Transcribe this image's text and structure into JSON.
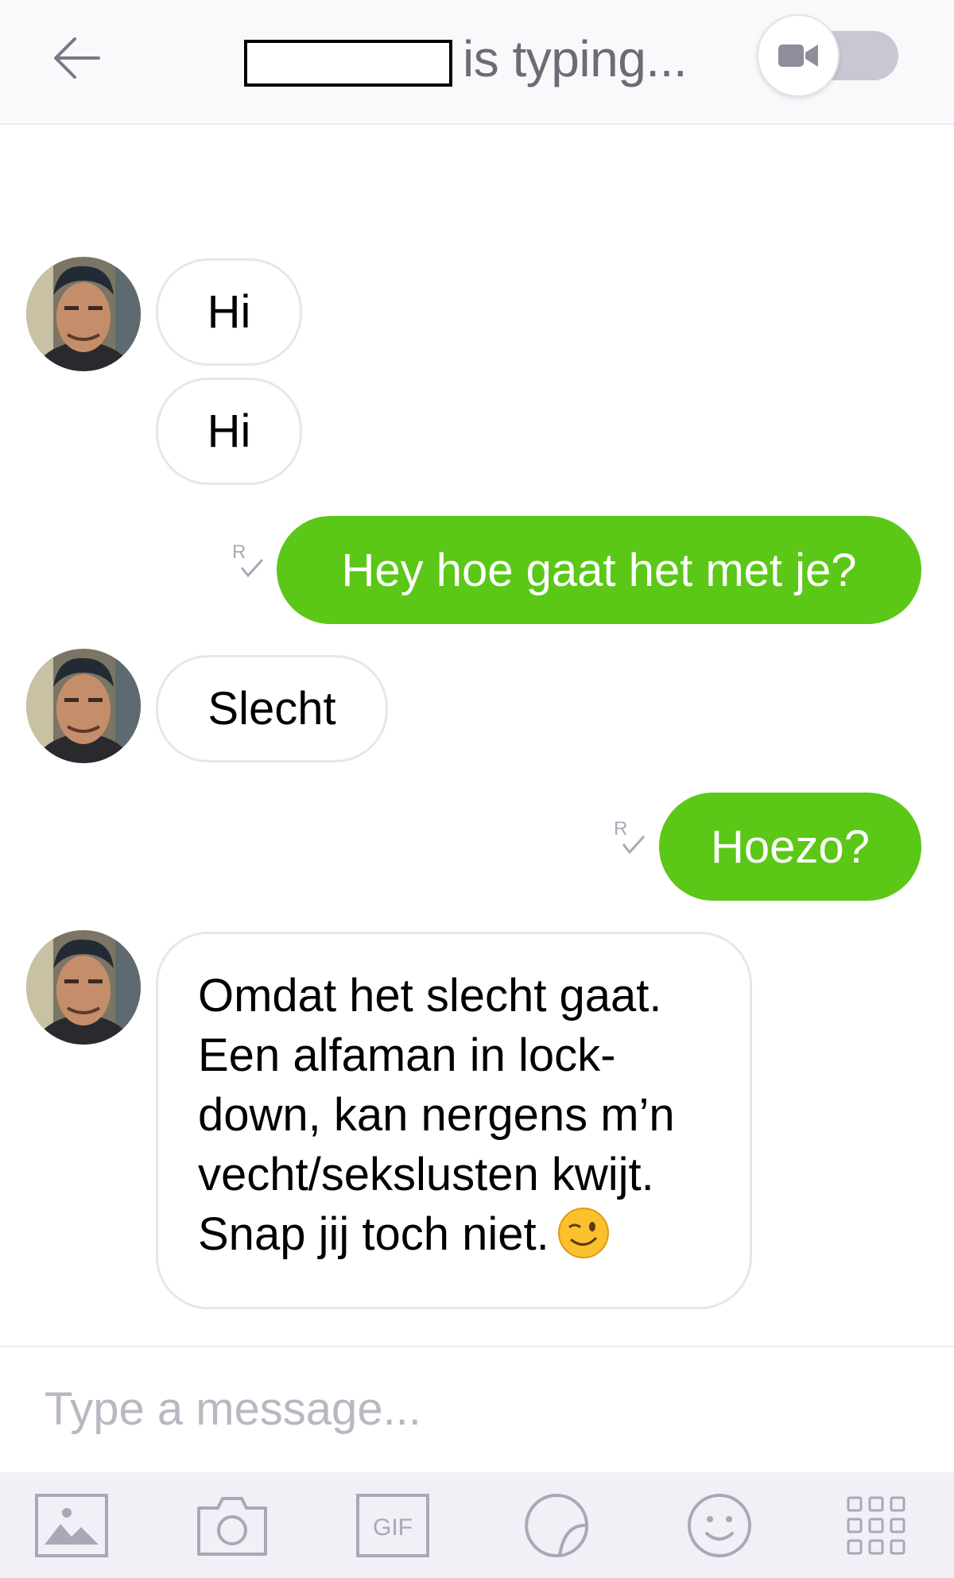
{
  "header": {
    "status_text": "is typing...",
    "back_icon": "arrow-left-icon",
    "video_icon": "video-camera-icon"
  },
  "messages": [
    {
      "direction": "incoming",
      "text": "Hi"
    },
    {
      "direction": "incoming",
      "text": "Hi"
    },
    {
      "direction": "outgoing",
      "text": "Hey hoe gaat het met je?",
      "receipt": "R"
    },
    {
      "direction": "incoming",
      "text": "Slecht"
    },
    {
      "direction": "outgoing",
      "text": "Hoezo?",
      "receipt": "R"
    },
    {
      "direction": "incoming",
      "lines": [
        "Omdat het slecht gaat.",
        "Een alfaman in lock-",
        "down, kan nergens m’n",
        "vecht/sekslusten kwijt.",
        "Snap jij toch niet."
      ],
      "emoji": "winking-face-emoji"
    }
  ],
  "input": {
    "placeholder": "Type a message..."
  },
  "toolbar": {
    "gif_label": "GIF",
    "tools": [
      "image-icon",
      "camera-icon",
      "gif-icon",
      "sticker-icon",
      "smiley-icon",
      "apps-grid-icon"
    ]
  },
  "colors": {
    "outgoing_bubble": "#5bc717",
    "header_bg": "#f9f8fb",
    "toolbar_bg": "#f1f0f7",
    "icon_gray": "#a9a8b6"
  }
}
